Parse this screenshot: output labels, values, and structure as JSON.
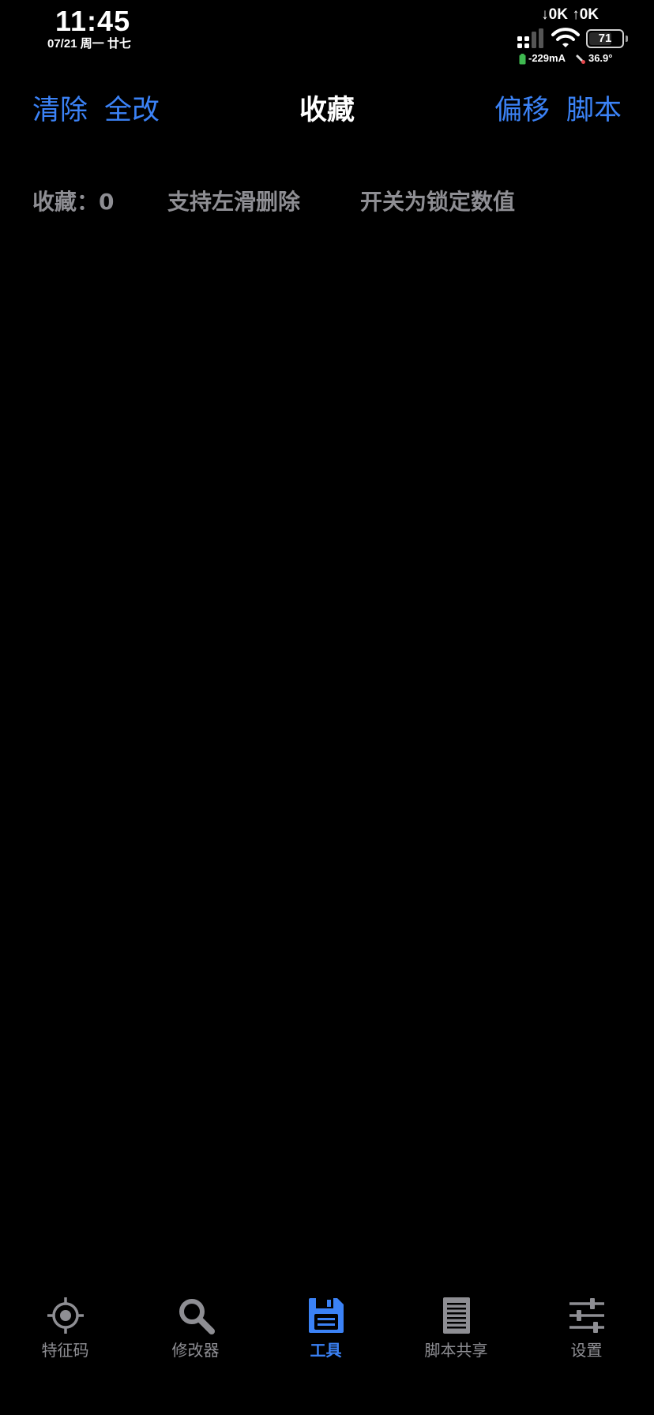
{
  "status_bar": {
    "time": "11:45",
    "date": "07/21 周一 廿七",
    "net_speed": "↓0K ↑0K",
    "battery_level": "71",
    "battery_fraction": 0.71,
    "current": "-229mA",
    "temperature": "36.9°"
  },
  "nav": {
    "clear_label": "清除",
    "modify_all_label": "全改",
    "title": "收藏",
    "offset_label": "偏移",
    "script_label": "脚本"
  },
  "info": {
    "count_label": "收藏：0",
    "swipe_hint": "支持左滑删除",
    "toggle_hint": "开关为锁定数值"
  },
  "tabs": [
    {
      "label": "特征码",
      "icon": "crosshair-icon",
      "active": false
    },
    {
      "label": "修改器",
      "icon": "magnifier-icon",
      "active": false
    },
    {
      "label": "工具",
      "icon": "floppy-disk-icon",
      "active": true
    },
    {
      "label": "脚本共享",
      "icon": "document-icon",
      "active": false
    },
    {
      "label": "设置",
      "icon": "sliders-icon",
      "active": false
    }
  ],
  "colors": {
    "accent": "#3b82f6",
    "inactive": "#8e8e93",
    "background": "#000000"
  }
}
